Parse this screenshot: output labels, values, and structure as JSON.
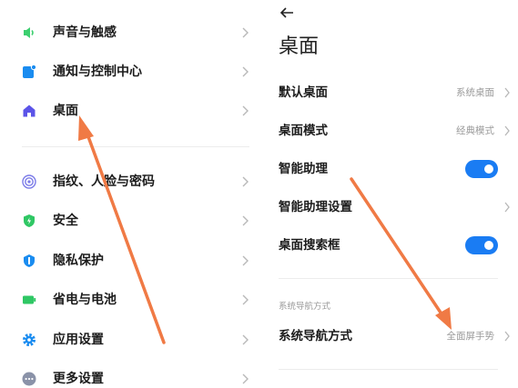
{
  "left": {
    "items": [
      {
        "label": "声音与触感",
        "icon": "speaker-icon",
        "color": "#3ccf6f"
      },
      {
        "label": "通知与控制中心",
        "icon": "notification-icon",
        "color": "#1a8cf0"
      },
      {
        "label": "桌面",
        "icon": "home-icon",
        "color": "#5b54e8"
      },
      {
        "label": "指纹、人脸与密码",
        "icon": "fingerprint-icon",
        "color": "#7b7be8"
      },
      {
        "label": "安全",
        "icon": "shield-icon",
        "color": "#2fc764"
      },
      {
        "label": "隐私保护",
        "icon": "privacy-icon",
        "color": "#1a8cf0"
      },
      {
        "label": "省电与电池",
        "icon": "battery-icon",
        "color": "#2fc764"
      },
      {
        "label": "应用设置",
        "icon": "gear-icon",
        "color": "#1a8cf0"
      },
      {
        "label": "更多设置",
        "icon": "more-icon",
        "color": "#8a92a8"
      }
    ]
  },
  "right": {
    "title": "桌面",
    "rows": [
      {
        "label": "默认桌面",
        "value": "系统桌面"
      },
      {
        "label": "桌面模式",
        "value": "经典模式"
      },
      {
        "label": "智能助理",
        "toggle": true
      },
      {
        "label": "智能助理设置"
      },
      {
        "label": "桌面搜索框",
        "toggle": true
      }
    ],
    "section_title": "系统导航方式",
    "nav_row": {
      "label": "系统导航方式",
      "value": "全面屏手势"
    }
  },
  "colors": {
    "accent": "#1a7cf3",
    "annotation_arrow": "#f07a45"
  }
}
